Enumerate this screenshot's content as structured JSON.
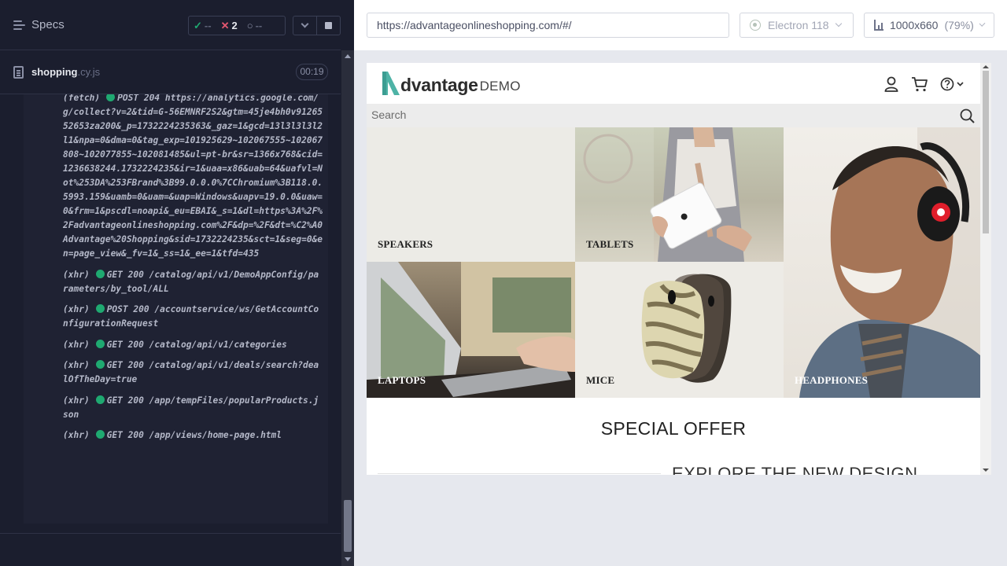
{
  "runner": {
    "specs_label": "Specs",
    "stats": {
      "passed": "--",
      "failed": "2",
      "pending": "--"
    },
    "spec_file": {
      "name": "shopping",
      "ext": ".cy.js"
    },
    "duration": "00:19",
    "log": [
      {
        "type": "(fetch)",
        "method": "POST",
        "status": "204",
        "url": "https://analytics.google.com/g/collect?v=2&tid=G-56EMNRF2S2&gtm=45je4bh0v9126552653za200&_p=1732224235363&_gaz=1&gcd=13l3l3l3l2l1&npa=0&dma=0&tag_exp=101925629~102067555~102067808~102077855~102081485&ul=pt-br&sr=1366x768&cid=1236638244.1732224235&ir=1&uaa=x86&uab=64&uafvl=Not%253DA%253FBrand%3B99.0.0.0%7CChromium%3B118.0.5993.159&uamb=0&uam=&uap=Windows&uapv=19.0.0&uaw=0&frm=1&pscdl=noapi&_eu=EBAI&_s=1&dl=https%3A%2F%2Fadvantageonlineshopping.com%2F&dp=%2F&dt=%C2%A0Advantage%20Shopping&sid=1732224235&sct=1&seg=0&en=page_view&_fv=1&_ss=1&_ee=1&tfd=435"
      },
      {
        "type": "(xhr)",
        "method": "GET",
        "status": "200",
        "url": "/catalog/api/v1/DemoAppConfig/parameters/by_tool/ALL"
      },
      {
        "type": "(xhr)",
        "method": "POST",
        "status": "200",
        "url": "/accountservice/ws/GetAccountConfigurationRequest"
      },
      {
        "type": "(xhr)",
        "method": "GET",
        "status": "200",
        "url": "/catalog/api/v1/categories"
      },
      {
        "type": "(xhr)",
        "method": "GET",
        "status": "200",
        "url": "/catalog/api/v1/deals/search?dealOfTheDay=true"
      },
      {
        "type": "(xhr)",
        "method": "GET",
        "status": "200",
        "url": "/app/tempFiles/popularProducts.json"
      },
      {
        "type": "(xhr)",
        "method": "GET",
        "status": "200",
        "url": "/app/views/home-page.html"
      }
    ]
  },
  "preview": {
    "url": "https://advantageonlineshopping.com/#/",
    "browser": "Electron 118",
    "viewport": "1000x660",
    "scale": "(79%)"
  },
  "site": {
    "logo_word": "dvantage",
    "logo_demo": "DEMO",
    "search_placeholder": "Search",
    "categories": [
      "SPEAKERS",
      "TABLETS",
      "HEADPHONES",
      "LAPTOPS",
      "MICE"
    ],
    "special_offer": "SPECIAL OFFER",
    "explore": "EXPLORE THE NEW DESIGN"
  },
  "colors": {
    "pass": "#1fa971",
    "fail": "#e45770",
    "runner_bg": "#1b1e2e",
    "brand_teal": "#4eb3a6"
  }
}
